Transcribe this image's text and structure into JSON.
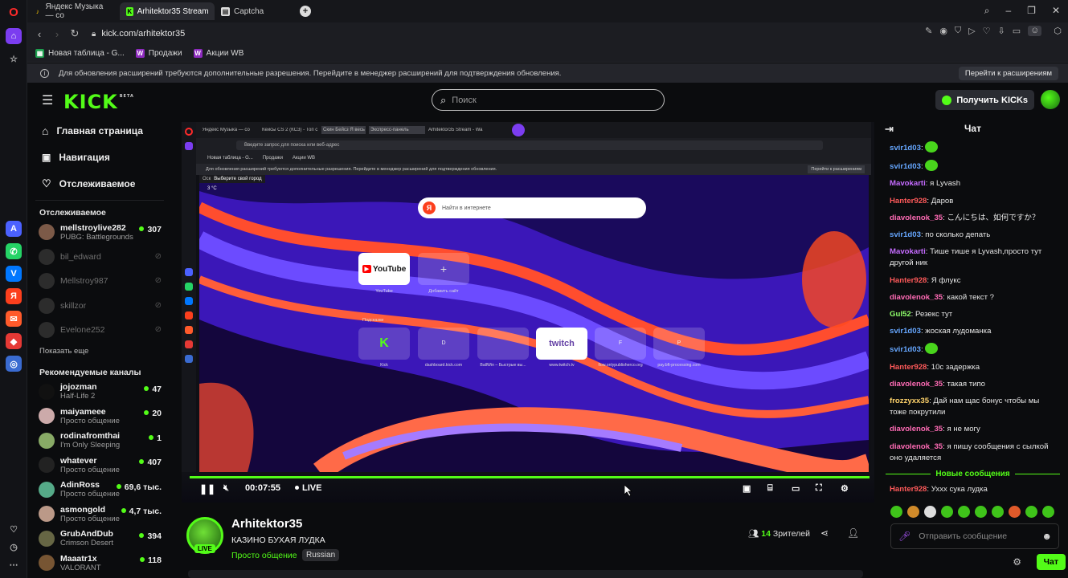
{
  "browser": {
    "tabs": [
      {
        "label": "Яндекс Музыка — со"
      },
      {
        "label": "Arhitektor35 Stream - Wa"
      },
      {
        "label": "Captcha"
      }
    ],
    "new_tab": "+",
    "url": "kick.com/arhitektor35",
    "bookmarks": [
      {
        "label": "Новая таблица - G..."
      },
      {
        "label": "Продажи"
      },
      {
        "label": "Акции WB"
      }
    ],
    "infobar": {
      "text": "Для обновления расширений требуются дополнительные разрешения. Перейдите в менеджер расширений для подтверждения обновления.",
      "button": "Перейти к расширениям"
    }
  },
  "kick": {
    "logo": "KICK",
    "logo_beta": "BETA",
    "search_placeholder": "Поиск",
    "get_kicks": "Получить KICKs",
    "brand_color": "#53fc18"
  },
  "nav": {
    "items": [
      {
        "label": "Главная страница",
        "icon": "home-icon"
      },
      {
        "label": "Навигация",
        "icon": "compass-icon"
      },
      {
        "label": "Отслеживаемое",
        "icon": "heart-icon"
      }
    ],
    "following_title": "Отслеживаемое",
    "following": [
      {
        "name": "mellstroylive282",
        "sub": "PUBG: Battlegrounds",
        "count": "307",
        "online": true
      },
      {
        "name": "bil_edward",
        "online": false
      },
      {
        "name": "Mellstroy987",
        "online": false
      },
      {
        "name": "skillzor",
        "online": false
      },
      {
        "name": "Evelone252",
        "online": false
      }
    ],
    "show_more": "Показать еще",
    "recommended_title": "Рекомендуемые каналы",
    "recommended": [
      {
        "name": "jojozman",
        "sub": "Half-Life 2",
        "count": "47"
      },
      {
        "name": "maiyameee",
        "sub": "Просто общение",
        "count": "20"
      },
      {
        "name": "rodinafromthai",
        "sub": "I'm Only Sleeping",
        "count": "1"
      },
      {
        "name": "whatever",
        "sub": "Просто общение",
        "count": "407"
      },
      {
        "name": "AdinRoss",
        "sub": "Просто общение",
        "count": "69,6 тыс."
      },
      {
        "name": "asmongold",
        "sub": "Просто общение",
        "count": "4,7 тыс."
      },
      {
        "name": "GrubAndDub",
        "sub": "Crimson Desert",
        "count": "394"
      },
      {
        "name": "Maaatr1x",
        "sub": "VALORANT",
        "count": "118"
      }
    ]
  },
  "video": {
    "inner_tabs": [
      "Яндекс Музыка — со",
      "Кейсы CS 2 (КСЗ) - Топ с",
      "Скин Бейсз Я весь",
      "Экспресс-панель",
      "Arhitektor35 Stream - Wa"
    ],
    "inner_address": "Введите запрос для поиска или веб-адрес",
    "inner_bookmarks": [
      "Новая таблица - G...",
      "Продажи",
      "Акции WB"
    ],
    "inner_info": "Для обновления расширений требуются дополнительные разрешения. Перейдите в менеджер расширений для подтверждения обновления.",
    "inner_info_btn": "Перейти к расширениям",
    "city_badge": "Выберите свой город",
    "osc": "Оск",
    "temp": "3 °C",
    "yandex_placeholder": "Найти в интернете",
    "speed_dials_top": [
      {
        "label": "YouTube"
      },
      {
        "label": "Добавить сайт"
      }
    ],
    "hints_title": "Подсказки",
    "speed_dials": [
      {
        "tile": "K",
        "label": "Kick"
      },
      {
        "tile": "D",
        "label": "dashboard.kick.com"
      },
      {
        "tile": "",
        "label": "BallWin – Быстрые вы..."
      },
      {
        "tile": "twitch",
        "label": "www.twitch.tv"
      },
      {
        "tile": "F",
        "label": "flow.onlypublisherco.org"
      },
      {
        "tile": "P",
        "label": "pay.bft-processing.com"
      }
    ],
    "time": "00:07:55",
    "live_label": "LIVE"
  },
  "stream": {
    "name": "Arhitektor35",
    "title": "КАЗИНО БУХАЯ ЛУДКА",
    "category": "Просто общение",
    "language": "Russian",
    "live_badge": "LIVE",
    "viewers_count": "14",
    "viewers_label": "Зрителей"
  },
  "chat": {
    "title": "Чат",
    "messages": [
      {
        "user": "svir1d03",
        "color": "#66a7ff",
        "text": "",
        "emote": true
      },
      {
        "user": "svir1d03",
        "color": "#66a7ff",
        "text": "",
        "emote": true
      },
      {
        "user": "Mavokarti",
        "color": "#c56bff",
        "text": "я Lyvash"
      },
      {
        "user": "Hanter928",
        "color": "#ff5a5a",
        "text": "Даров"
      },
      {
        "user": "diavolenok_35",
        "color": "#ff6bb5",
        "text": "こんにちは、如何ですか？"
      },
      {
        "user": "svir1d03",
        "color": "#66a7ff",
        "text": "по сколько депать"
      },
      {
        "user": "Mavokarti",
        "color": "#c56bff",
        "text": "Тише тише я Lyvash,просто тут другой ник"
      },
      {
        "user": "Hanter928",
        "color": "#ff5a5a",
        "text": "Я флукс"
      },
      {
        "user": "diavolenok_35",
        "color": "#ff6bb5",
        "text": "какой текст ?"
      },
      {
        "user": "Gul52",
        "color": "#8fff6b",
        "text": "Резекс тут"
      },
      {
        "user": "svir1d03",
        "color": "#66a7ff",
        "text": "жоская лудоманка"
      },
      {
        "user": "svir1d03",
        "color": "#66a7ff",
        "text": "",
        "emote": true
      },
      {
        "user": "Hanter928",
        "color": "#ff5a5a",
        "text": "10с задержка"
      },
      {
        "user": "diavolenok_35",
        "color": "#ff6bb5",
        "text": "такая типо"
      },
      {
        "user": "frozzyxx35",
        "color": "#ffd36b",
        "text": "Дай нам щас бонус чтобы мы тоже покрутили"
      },
      {
        "user": "diavolenok_35",
        "color": "#ff6bb5",
        "text": "я не могу"
      },
      {
        "user": "diavolenok_35",
        "color": "#ff6bb5",
        "text": "я пишу сообщения с сылкой оно удаляется"
      }
    ],
    "new_messages": "Новые сообщения",
    "after_messages": [
      {
        "user": "Hanter928",
        "color": "#ff5a5a",
        "text": "Ухxx сука лудка"
      }
    ],
    "input_placeholder": "Отправить сообщение",
    "send_button": "Чат"
  }
}
